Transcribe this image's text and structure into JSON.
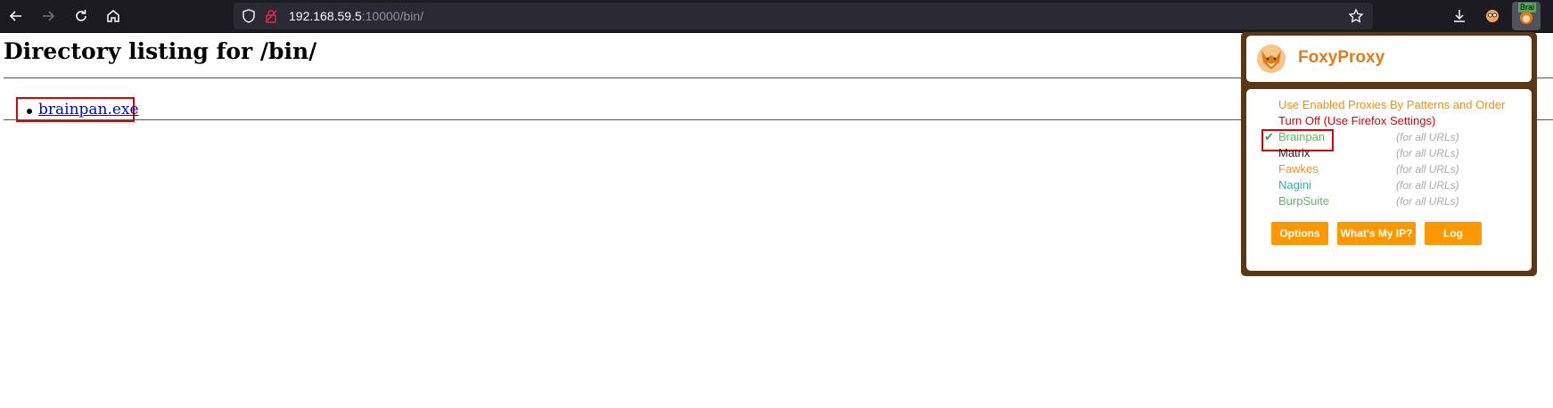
{
  "browser": {
    "url_host": "192.168.59.5",
    "url_rest": ":10000/bin/",
    "extension_badge": "Brai",
    "icons": [
      "back-icon",
      "forward-icon",
      "reload-icon",
      "home-icon",
      "shield-icon",
      "lock-icon",
      "star-icon",
      "download-icon",
      "extension-icon",
      "foxyproxy-icon"
    ]
  },
  "page": {
    "title": "Directory listing for /bin/",
    "files": [
      {
        "name": "brainpan.exe"
      }
    ]
  },
  "foxyproxy": {
    "title": "FoxyProxy",
    "modes": [
      {
        "label": "Use Enabled Proxies By Patterns and Order",
        "color": "#ff8c00"
      },
      {
        "label": "Turn Off (Use Firefox Settings)",
        "color": "#e00000"
      }
    ],
    "proxies": [
      {
        "name": "Brainpan",
        "pattern": "(for all URLs)",
        "color": "#55c155",
        "selected": true,
        "check": "✔"
      },
      {
        "name": "Matrix",
        "pattern": "(for all URLs)",
        "color": "#222222",
        "selected": false
      },
      {
        "name": "Fawkes",
        "pattern": "(for all URLs)",
        "color": "#f0901e",
        "selected": false
      },
      {
        "name": "Nagini",
        "pattern": "(for all URLs)",
        "color": "#1fb4d0",
        "selected": false
      },
      {
        "name": "BurpSuite",
        "pattern": "(for all URLs)",
        "color": "#55c155",
        "selected": false
      }
    ],
    "buttons": {
      "options": "Options",
      "whats_my_ip": "What's My IP?",
      "log": "Log"
    },
    "accent_color": "#ff9800",
    "frame_color": "#5b3813"
  }
}
